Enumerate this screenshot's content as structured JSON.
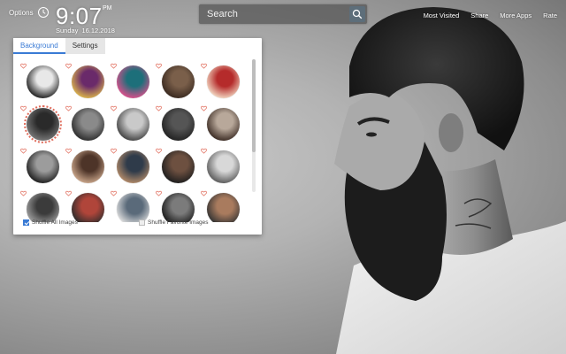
{
  "header": {
    "options_label": "Options",
    "clock_icon": "clock-icon",
    "time": "9:07",
    "ampm": "PM",
    "weekday": "Sunday",
    "date": "16.12.2018"
  },
  "search": {
    "placeholder": "Search",
    "icon": "search-icon"
  },
  "top_links": [
    "Most Visited",
    "Share",
    "More Apps",
    "Rate"
  ],
  "panel": {
    "tabs": [
      {
        "label": "Background",
        "active": true
      },
      {
        "label": "Settings",
        "active": false
      }
    ],
    "thumb_count": 25,
    "selected_thumb": 5,
    "shuffle_all_label": "Shuffle All Images",
    "shuffle_all_checked": true,
    "shuffle_favorite_label": "Shuffle Favorite Images",
    "shuffle_favorite_checked": false
  },
  "colors": {
    "accent": "#3a7bd5",
    "heart": "#e06b5a"
  }
}
